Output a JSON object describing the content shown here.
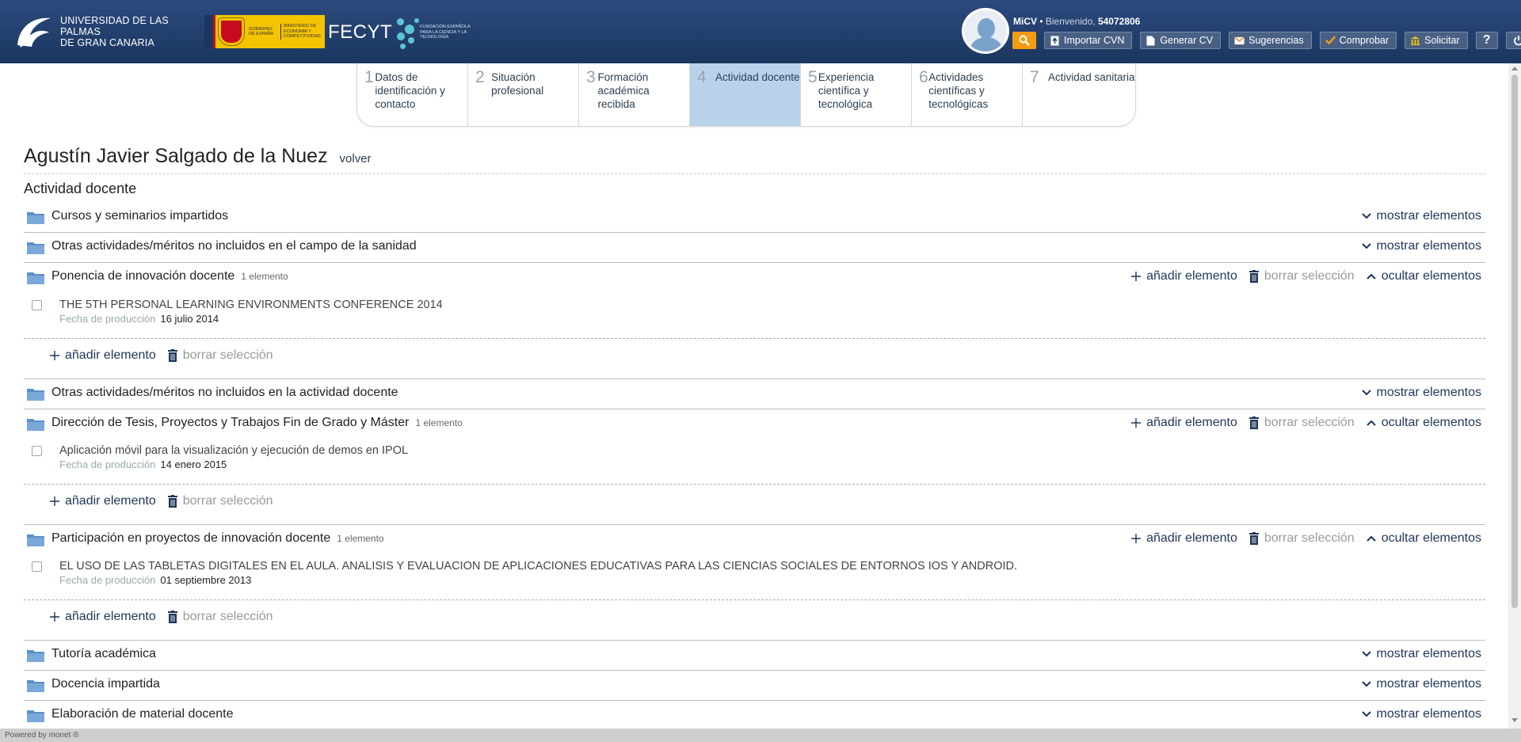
{
  "header": {
    "ulpgc_line1": "UNIVERSIDAD DE LAS PALMAS",
    "ulpgc_line2": "DE GRAN CANARIA",
    "gobierno_text": "GOBIERNO DE ESPAÑA",
    "ministerio_text": "MINISTERIO DE ECONOMÍA Y COMPETITIVIDAD",
    "fecyt_text": "FECYT",
    "fecyt_sub": "FUNDACIÓN ESPAÑOLA PARA LA CIENCIA Y LA TECNOLOGÍA",
    "app_name": "MiCV",
    "bullet": "•",
    "welcome": "Bienvenido,",
    "user_id": "54072806",
    "buttons": {
      "importar": "Importar CVN",
      "generar": "Generar CV",
      "sugerencias": "Sugerencias",
      "comprobar": "Comprobar",
      "solicitar": "Solicitar",
      "help": "?"
    }
  },
  "steps": [
    {
      "num": "1",
      "label": "Datos de identificación y contacto"
    },
    {
      "num": "2",
      "label": "Situación profesional"
    },
    {
      "num": "3",
      "label": "Formación académica recibida"
    },
    {
      "num": "4",
      "label": "Actividad docente"
    },
    {
      "num": "5",
      "label": "Experiencia científica y tecnológica"
    },
    {
      "num": "6",
      "label": "Actividades científicas y tecnológicas"
    },
    {
      "num": "7",
      "label": "Actividad sanitaria"
    }
  ],
  "main": {
    "person_name": "Agustín Javier Salgado de la Nuez",
    "back_label": "volver",
    "section_title": "Actividad docente",
    "labels": {
      "show": "mostrar elementos",
      "hide": "ocultar elementos",
      "add": "añadir elemento",
      "delete": "borrar selección",
      "date_label": "Fecha de producción"
    },
    "rows": [
      {
        "title": "Cursos y seminarios impartidos"
      },
      {
        "title": "Otras actividades/méritos no incluidos en el campo de la sanidad"
      },
      {
        "title": "Ponencia de innovación docente",
        "count": "1 elemento",
        "item": {
          "title": "THE 5TH PERSONAL LEARNING ENVIRONMENTS CONFERENCE 2014",
          "date": "16 julio 2014"
        }
      },
      {
        "title": "Otras actividades/méritos no incluidos en la actividad docente"
      },
      {
        "title": "Dirección de Tesis, Proyectos y Trabajos Fin de Grado y Máster",
        "count": "1 elemento",
        "item": {
          "title": "Aplicación móvil para la visualización y ejecución de demos en IPOL",
          "date": "14 enero 2015"
        }
      },
      {
        "title": "Participación en proyectos de innovación docente",
        "count": "1 elemento",
        "item": {
          "title": "EL USO DE LAS TABLETAS DIGITALES EN EL AULA. ANALISIS Y EVALUACION DE APLICACIONES EDUCATIVAS PARA LAS CIENCIAS SOCIALES DE ENTORNOS IOS Y ANDROID.",
          "date": "01 septiembre 2013"
        }
      },
      {
        "title": "Tutoría académica"
      },
      {
        "title": "Docencia impartida"
      },
      {
        "title": "Elaboración de material docente"
      }
    ]
  },
  "footer": {
    "text": "Powered by monet ®"
  },
  "colors": {
    "header": "#1b365f",
    "active_step": "#b9d2ec",
    "search_button": "#f39c12",
    "folder": "#5b8fc7"
  }
}
